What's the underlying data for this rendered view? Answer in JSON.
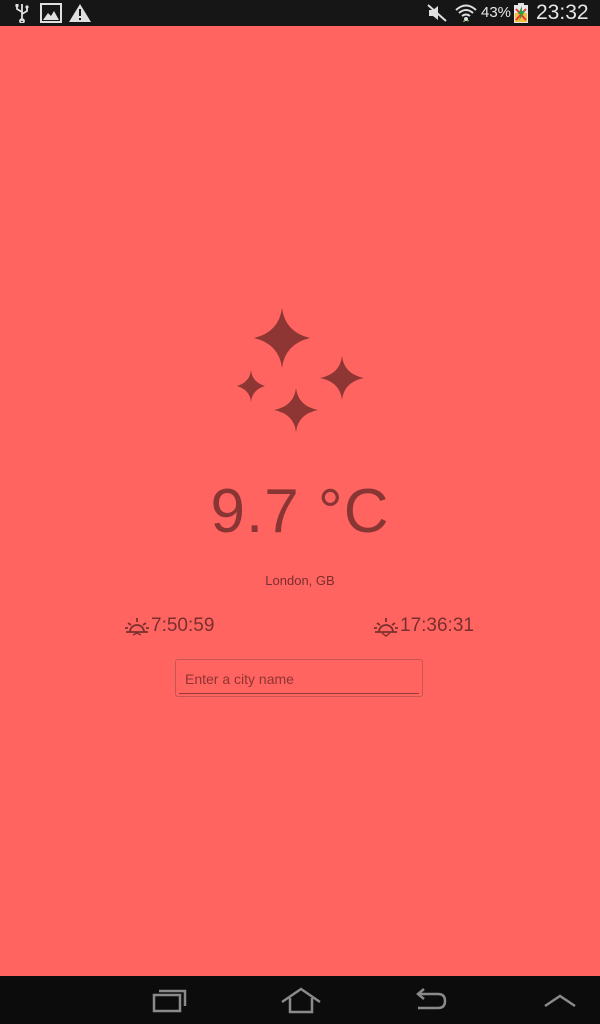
{
  "status_bar": {
    "battery_percent": "43%",
    "clock": "23:32",
    "icons": [
      "usb-icon",
      "gallery-icon",
      "warning-icon",
      "mute-icon",
      "wifi-icon",
      "battery-icon"
    ]
  },
  "weather": {
    "icon": "clear-night-stars-icon",
    "temperature": "9.7 °C",
    "location": "London, GB",
    "sunrise": "7:50:59",
    "sunset": "17:36:31"
  },
  "search": {
    "placeholder": "Enter a city name",
    "value": ""
  },
  "nav_bar": {
    "buttons": [
      "recent-apps-icon",
      "home-icon",
      "back-icon",
      "menu-up-icon"
    ]
  },
  "colors": {
    "background": "#ff6461",
    "foreground": "#893533",
    "status_bar": "#161616",
    "nav_bar": "#0c0c0c"
  }
}
